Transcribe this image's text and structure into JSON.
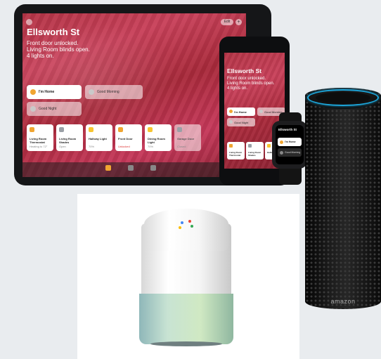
{
  "ipad": {
    "home_title": "Ellsworth St",
    "status_lines": [
      "Front door unlocked.",
      "Living Room blinds open.",
      "4 lights on."
    ],
    "edit_label": "Edit",
    "scenes": [
      {
        "label": "I'm Home"
      },
      {
        "label": "Good Morning"
      },
      {
        "label": "Good Night"
      }
    ],
    "accessories": [
      {
        "name": "Living Room Thermostat",
        "status": "Heating to 72°",
        "icon_color": "#f0a531"
      },
      {
        "name": "Living Room Shades",
        "status": "Open",
        "icon_color": "#9aa0a6"
      },
      {
        "name": "Hallway Light",
        "status": "70%",
        "icon_color": "#f7c531"
      },
      {
        "name": "Front Door",
        "status": "Unlocked",
        "icon_color": "#f0a531"
      },
      {
        "name": "Dining Room Light",
        "status": "70%",
        "icon_color": "#f7c531"
      },
      {
        "name": "Garage Door",
        "status": "Closed",
        "icon_color": "#9aa0a6"
      }
    ]
  },
  "iphone": {
    "home_title": "Ellsworth St",
    "status_lines": [
      "Front door unlocked.",
      "Living Room blinds open.",
      "4 lights on."
    ],
    "scenes": [
      {
        "label": "I'm Home"
      },
      {
        "label": "Good Morning"
      },
      {
        "label": "Good Night"
      }
    ],
    "accessories": [
      {
        "name": "Living Room Thermostat",
        "icon_color": "#f0a531"
      },
      {
        "name": "Living Room Shades",
        "icon_color": "#9aa0a6"
      },
      {
        "name": "Hallway Light",
        "icon_color": "#f7c531"
      }
    ]
  },
  "watch": {
    "title": "Ellsworth St",
    "scenes": [
      {
        "label": "I'm Home"
      },
      {
        "label": "Good Morning"
      }
    ]
  },
  "echo": {
    "logo": "amazon",
    "ring_color": "#1ca5d9"
  },
  "google_home": {
    "dot_colors": [
      "#4285f4",
      "#ea4335",
      "#fbbc05",
      "#34a853"
    ]
  }
}
